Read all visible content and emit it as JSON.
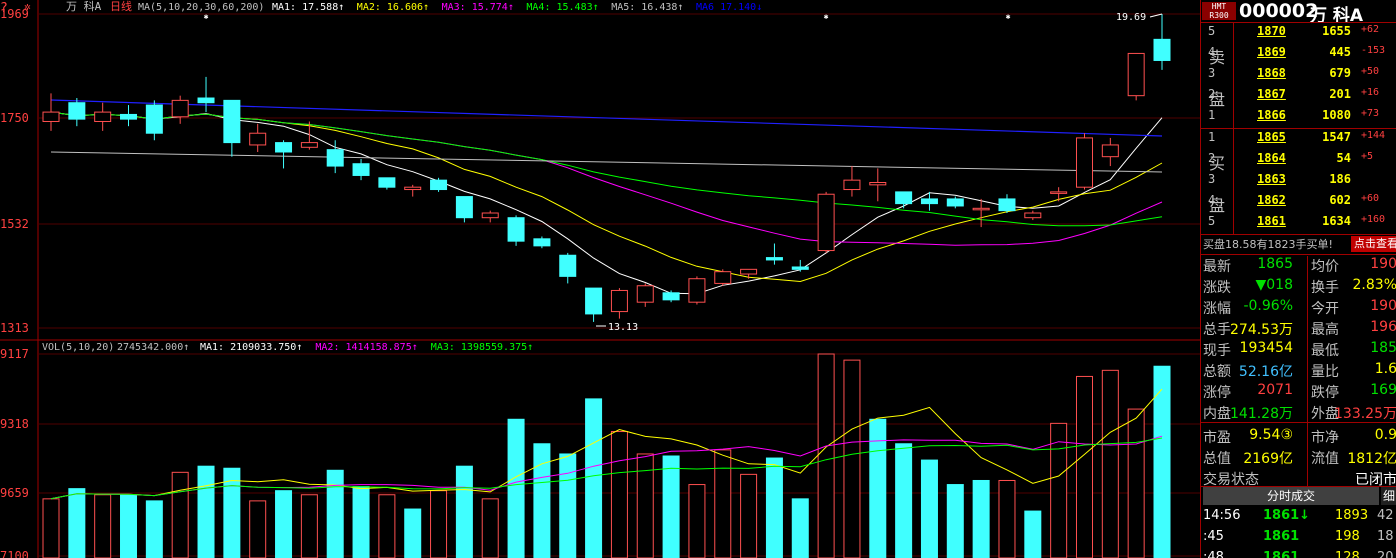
{
  "chart_header": {
    "stock": "万 科A",
    "period": "日线",
    "ma_params": "MA(5,10,20,30,60,200)",
    "ma_values": [
      {
        "label": "MA1: 17.588↑",
        "color": "#ffffff"
      },
      {
        "label": "MA2: 16.606↑",
        "color": "#ffff00"
      },
      {
        "label": "MA3: 15.774↑",
        "color": "#ff00ff"
      },
      {
        "label": "MA4: 15.483↑",
        "color": "#00ff00"
      },
      {
        "label": "MA5: 16.438↑",
        "color": "#c0c0c0"
      },
      {
        "label": "MA6  17.140↓",
        "color": "#0000ff"
      }
    ]
  },
  "vol_header": {
    "params": "VOL(5,10,20)",
    "value": "2745342.000↑",
    "ma_values": [
      {
        "label": "MA1: 2109033.750↑",
        "color": "#ffffff"
      },
      {
        "label": "MA2: 1414158.875↑",
        "color": "#ff00ff"
      },
      {
        "label": "MA3: 1398559.375↑",
        "color": "#00ff00"
      }
    ]
  },
  "price_axis": [
    "1969",
    "1750",
    "1532",
    "1313"
  ],
  "vol_axis": [
    "9117",
    "9318",
    "9659",
    "7100"
  ],
  "annotations": {
    "high": "19.69",
    "low": "13.13"
  },
  "colors": {
    "up": "#ff5050",
    "down": "#40ffff",
    "grid": "#a00000"
  },
  "chart_data": {
    "type": "candlestick",
    "price_range": [
      13.0,
      19.75
    ],
    "candles": [
      {
        "o": 17.4,
        "h": 18.0,
        "l": 17.2,
        "c": 17.6
      },
      {
        "o": 17.8,
        "h": 17.9,
        "l": 17.3,
        "c": 17.45
      },
      {
        "o": 17.4,
        "h": 17.8,
        "l": 17.2,
        "c": 17.6
      },
      {
        "o": 17.55,
        "h": 17.75,
        "l": 17.3,
        "c": 17.45
      },
      {
        "o": 17.75,
        "h": 17.85,
        "l": 17.0,
        "c": 17.15
      },
      {
        "o": 17.5,
        "h": 17.95,
        "l": 17.35,
        "c": 17.85
      },
      {
        "o": 17.9,
        "h": 18.35,
        "l": 17.6,
        "c": 17.8
      },
      {
        "o": 17.85,
        "h": 17.85,
        "l": 16.65,
        "c": 16.95
      },
      {
        "o": 16.9,
        "h": 17.35,
        "l": 16.75,
        "c": 17.15
      },
      {
        "o": 16.95,
        "h": 17.0,
        "l": 16.4,
        "c": 16.75
      },
      {
        "o": 16.85,
        "h": 17.4,
        "l": 16.8,
        "c": 16.95
      },
      {
        "o": 16.8,
        "h": 17.0,
        "l": 16.3,
        "c": 16.45
      },
      {
        "o": 16.5,
        "h": 16.6,
        "l": 16.15,
        "c": 16.25
      },
      {
        "o": 16.2,
        "h": 16.2,
        "l": 15.95,
        "c": 16.0
      },
      {
        "o": 15.95,
        "h": 16.05,
        "l": 15.8,
        "c": 16.0
      },
      {
        "o": 16.15,
        "h": 16.2,
        "l": 15.9,
        "c": 15.95
      },
      {
        "o": 15.8,
        "h": 15.8,
        "l": 15.25,
        "c": 15.35
      },
      {
        "o": 15.35,
        "h": 15.5,
        "l": 15.25,
        "c": 15.45
      },
      {
        "o": 15.35,
        "h": 15.4,
        "l": 14.75,
        "c": 14.85
      },
      {
        "o": 14.9,
        "h": 14.95,
        "l": 14.7,
        "c": 14.75
      },
      {
        "o": 14.55,
        "h": 14.6,
        "l": 13.95,
        "c": 14.1
      },
      {
        "o": 13.85,
        "h": 13.85,
        "l": 13.13,
        "c": 13.3
      },
      {
        "o": 13.35,
        "h": 13.85,
        "l": 13.2,
        "c": 13.8
      },
      {
        "o": 13.55,
        "h": 13.95,
        "l": 13.45,
        "c": 13.9
      },
      {
        "o": 13.75,
        "h": 13.8,
        "l": 13.55,
        "c": 13.6
      },
      {
        "o": 13.55,
        "h": 14.1,
        "l": 13.5,
        "c": 14.05
      },
      {
        "o": 13.95,
        "h": 14.25,
        "l": 13.9,
        "c": 14.2
      },
      {
        "o": 14.15,
        "h": 14.25,
        "l": 14.05,
        "c": 14.25
      },
      {
        "o": 14.5,
        "h": 14.8,
        "l": 14.35,
        "c": 14.45
      },
      {
        "o": 14.3,
        "h": 14.45,
        "l": 14.2,
        "c": 14.25
      },
      {
        "o": 14.65,
        "h": 15.9,
        "l": 14.6,
        "c": 15.85
      },
      {
        "o": 15.95,
        "h": 16.45,
        "l": 15.8,
        "c": 16.15
      },
      {
        "o": 16.05,
        "h": 16.4,
        "l": 15.7,
        "c": 16.1
      },
      {
        "o": 15.9,
        "h": 15.9,
        "l": 15.55,
        "c": 15.65
      },
      {
        "o": 15.75,
        "h": 15.9,
        "l": 15.5,
        "c": 15.65
      },
      {
        "o": 15.75,
        "h": 15.8,
        "l": 15.55,
        "c": 15.6
      },
      {
        "o": 15.55,
        "h": 15.75,
        "l": 15.15,
        "c": 15.55
      },
      {
        "o": 15.75,
        "h": 15.85,
        "l": 15.45,
        "c": 15.5
      },
      {
        "o": 15.35,
        "h": 15.5,
        "l": 15.3,
        "c": 15.45
      },
      {
        "o": 15.9,
        "h": 16.0,
        "l": 15.7,
        "c": 15.9
      },
      {
        "o": 16.0,
        "h": 17.15,
        "l": 15.95,
        "c": 17.05
      },
      {
        "o": 16.65,
        "h": 17.05,
        "l": 16.45,
        "c": 16.9
      },
      {
        "o": 17.95,
        "h": 18.85,
        "l": 17.85,
        "c": 18.85
      },
      {
        "o": 19.15,
        "h": 19.69,
        "l": 18.5,
        "c": 18.7
      }
    ],
    "volumes": [
      0.29,
      0.34,
      0.31,
      0.31,
      0.28,
      0.42,
      0.45,
      0.44,
      0.28,
      0.33,
      0.31,
      0.43,
      0.35,
      0.31,
      0.24,
      0.33,
      0.45,
      0.29,
      0.68,
      0.56,
      0.51,
      0.78,
      0.62,
      0.51,
      0.5,
      0.36,
      0.53,
      0.41,
      0.49,
      0.29,
      1.0,
      0.97,
      0.68,
      0.56,
      0.48,
      0.36,
      0.38,
      0.38,
      0.23,
      0.66,
      0.89,
      0.92,
      0.73,
      0.94
    ],
    "volume_up": [
      1,
      0,
      1,
      0,
      0,
      1,
      0,
      0,
      1,
      0,
      1,
      0,
      0,
      1,
      0,
      1,
      0,
      1,
      0,
      0,
      0,
      0,
      1,
      1,
      0,
      1,
      1,
      1,
      0,
      0,
      1,
      1,
      0,
      0,
      0,
      0,
      0,
      1,
      0,
      1,
      1,
      1,
      1,
      0
    ]
  },
  "panel": {
    "hmt": [
      "H",
      "M",
      "T",
      "R",
      "300"
    ],
    "code": "000002",
    "name": "万 科A",
    "sell_label": [
      "卖",
      "盘"
    ],
    "buy_label": [
      "买",
      "盘"
    ],
    "sell": [
      {
        "lvl": "5",
        "price": "1870",
        "vol": "1655",
        "chg": "+62"
      },
      {
        "lvl": "4",
        "price": "1869",
        "vol": "445",
        "chg": "-153"
      },
      {
        "lvl": "3",
        "price": "1868",
        "vol": "679",
        "chg": "+50"
      },
      {
        "lvl": "2",
        "price": "1867",
        "vol": "201",
        "chg": "+16"
      },
      {
        "lvl": "1",
        "price": "1866",
        "vol": "1080",
        "chg": "+73"
      }
    ],
    "buy": [
      {
        "lvl": "1",
        "price": "1865",
        "vol": "1547",
        "chg": "+144"
      },
      {
        "lvl": "2",
        "price": "1864",
        "vol": "54",
        "chg": "+5"
      },
      {
        "lvl": "3",
        "price": "1863",
        "vol": "186",
        "chg": ""
      },
      {
        "lvl": "4",
        "price": "1862",
        "vol": "602",
        "chg": "+60"
      },
      {
        "lvl": "5",
        "price": "1861",
        "vol": "1634",
        "chg": "+160"
      }
    ],
    "notice": "买盘18.58有1823手买单!",
    "notice_btn": "点击查看",
    "stats": [
      {
        "l1": "最新",
        "v1": "1865",
        "c1": "green",
        "l2": "均价",
        "v2": "190",
        "c2": "red"
      },
      {
        "l1": "涨跌",
        "v1": "▼018",
        "c1": "green",
        "l2": "换手",
        "v2": "2.83%",
        "c2": "yellow"
      },
      {
        "l1": "涨幅",
        "v1": "-0.96%",
        "c1": "green",
        "l2": "今开",
        "v2": "190",
        "c2": "red"
      },
      {
        "l1": "总手",
        "v1": "274.53万",
        "c1": "yellow",
        "l2": "最高",
        "v2": "196",
        "c2": "red"
      },
      {
        "l1": "现手",
        "v1": "193454",
        "c1": "yellow",
        "l2": "最低",
        "v2": "185",
        "c2": "green"
      },
      {
        "l1": "总额",
        "v1": "52.16亿",
        "c1": "cyan",
        "l2": "量比",
        "v2": "1.6",
        "c2": "yellow"
      },
      {
        "l1": "涨停",
        "v1": "2071",
        "c1": "red",
        "l2": "跌停",
        "v2": "169",
        "c2": "green"
      },
      {
        "l1": "内盘",
        "v1": "141.28万",
        "c1": "green",
        "l2": "外盘",
        "v2": "133.25万",
        "c2": "red"
      },
      {
        "l1": "市盈",
        "v1": "9.54③",
        "c1": "yellow",
        "l2": "市净",
        "v2": "0.9",
        "c2": "yellow"
      },
      {
        "l1": "总值",
        "v1": "2169亿",
        "c1": "yellow",
        "l2": "流值",
        "v2": "1812亿",
        "c2": "yellow"
      },
      {
        "l1": "交易状态",
        "v1": "",
        "c1": "white",
        "l2": "",
        "v2": "已闭市",
        "c2": "white"
      }
    ],
    "tabs": [
      "分时成交",
      "细"
    ],
    "ticks": [
      {
        "time": "14:56",
        "price": "1861↓",
        "vol": "1893",
        "n": "42"
      },
      {
        "time": ":45",
        "price": "1861",
        "vol": "198",
        "n": "18"
      },
      {
        "time": ":48",
        "price": "1861",
        "vol": "128",
        "n": "20"
      }
    ]
  }
}
